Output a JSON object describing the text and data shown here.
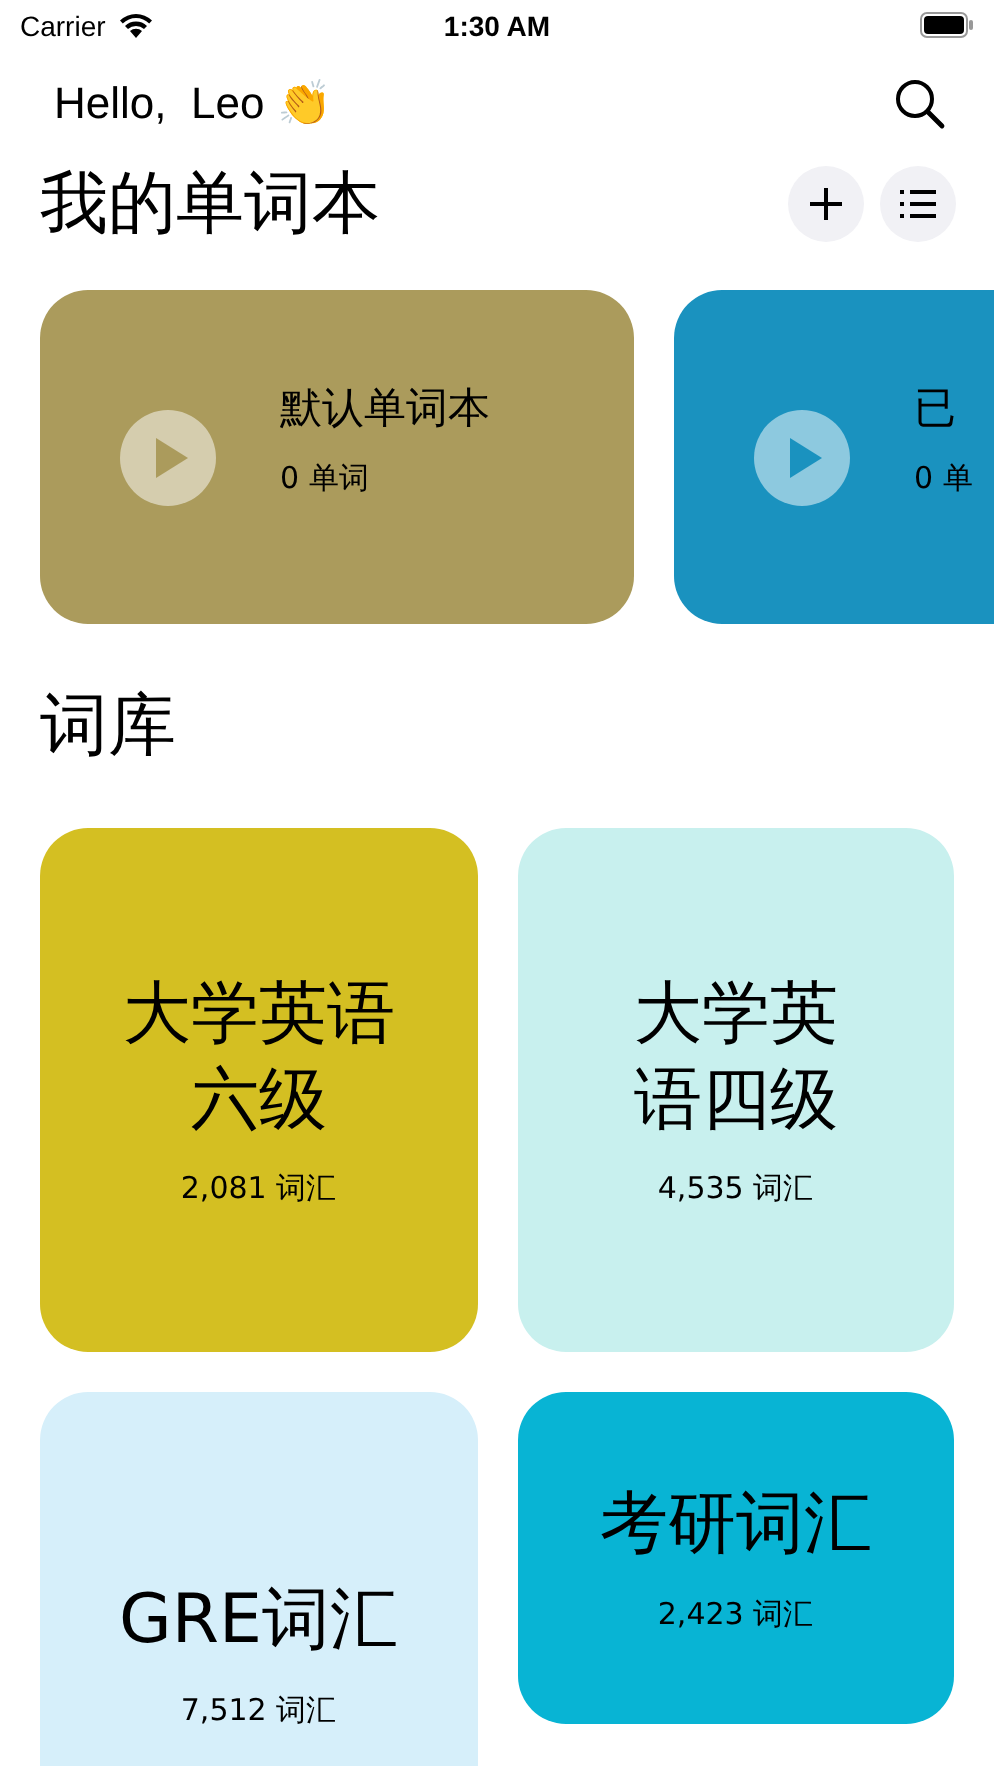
{
  "status_bar": {
    "carrier": "Carrier",
    "time": "1:30 AM"
  },
  "greeting": {
    "text": "Hello,  Leo",
    "emoji": "👏"
  },
  "notebooks": {
    "title": "我的单词本",
    "items": [
      {
        "name": "默认单词本",
        "count": "0 单词",
        "color": "#ab9b5c"
      },
      {
        "name": "已",
        "count": "0 单",
        "color": "#1a92bf"
      }
    ]
  },
  "library": {
    "title": "词库",
    "columns": [
      [
        {
          "title_lines": [
            "大学英语",
            "六级"
          ],
          "count": "2,081 词汇",
          "color": "#d4bf22",
          "kind": "tall"
        },
        {
          "title_lines": [
            "GRE词汇"
          ],
          "count": "7,512 词汇",
          "color": "#d6effa",
          "kind": "tall"
        }
      ],
      [
        {
          "title_lines": [
            "大学英",
            "语四级"
          ],
          "count": "4,535 词汇",
          "color": "#c8f0ee",
          "kind": "tall"
        },
        {
          "title_lines": [
            "考研词汇"
          ],
          "count": "2,423 词汇",
          "color": "#08b4d4",
          "kind": "short"
        }
      ]
    ]
  }
}
